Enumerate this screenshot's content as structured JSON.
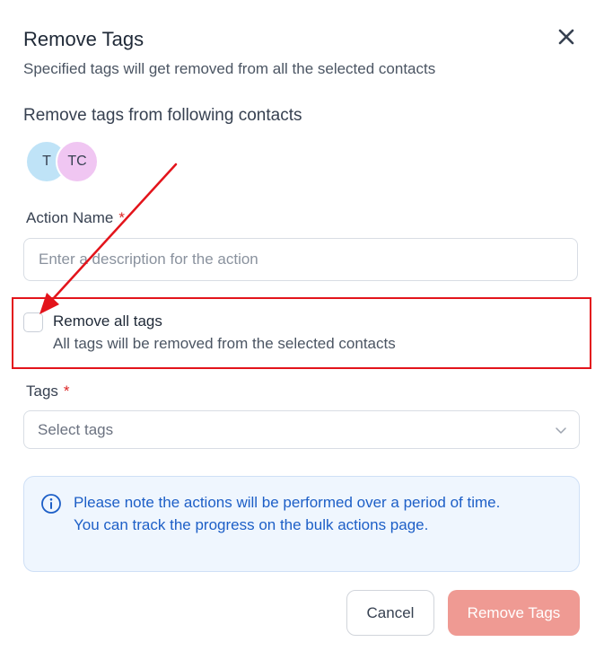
{
  "dialog": {
    "title": "Remove Tags",
    "subtitle": "Specified tags will get removed from all the selected contacts"
  },
  "contacts": {
    "section_label": "Remove tags from following contacts",
    "avatars": [
      "T",
      "TC"
    ]
  },
  "action_name": {
    "label": "Action Name",
    "required_mark": "*",
    "placeholder": "Enter a description for the action",
    "value": ""
  },
  "remove_all": {
    "checked": false,
    "label": "Remove all tags",
    "description": "All tags will be removed from the selected contacts"
  },
  "tags": {
    "label": "Tags",
    "required_mark": "*",
    "placeholder": "Select tags"
  },
  "info": {
    "text": "Please note the actions will be performed over a period of time. You can track the progress on the bulk actions page."
  },
  "buttons": {
    "cancel": "Cancel",
    "submit": "Remove Tags"
  },
  "colors": {
    "accent": "#1d5fc7",
    "danger_outline": "#e3141b",
    "submit_disabled": "#ef9a93",
    "info_bg": "#eff6fe"
  },
  "icons": {
    "close": "close-icon",
    "info": "info-icon",
    "select": "chevron-down-icon",
    "annotation": "red-arrow-annotation"
  }
}
